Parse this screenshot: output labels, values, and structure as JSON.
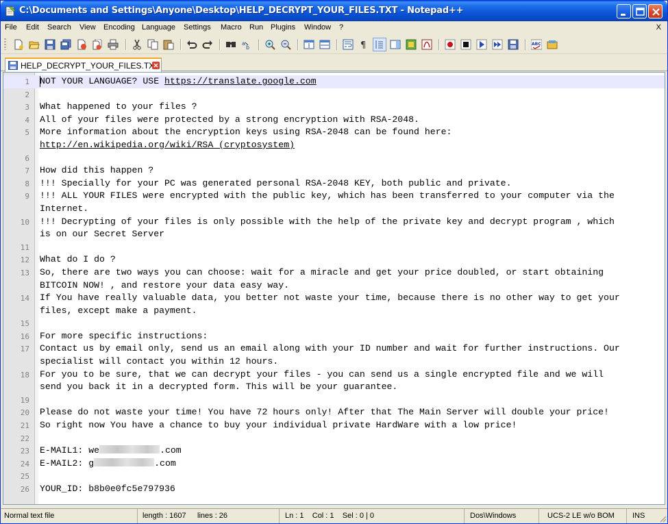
{
  "window": {
    "title": "C:\\Documents and Settings\\Anyone\\Desktop\\HELP_DECRYPT_YOUR_FILES.TXT - Notepad++"
  },
  "menu": [
    "File",
    "Edit",
    "Search",
    "View",
    "Encoding",
    "Language",
    "Settings",
    "Macro",
    "Run",
    "Plugins",
    "Window",
    "?"
  ],
  "menu_close": "X",
  "toolbar_icons": [
    "new-file-icon",
    "open-file-icon",
    "save-icon",
    "save-all-icon",
    "close-icon",
    "close-all-icon",
    "print-icon",
    "cut-icon",
    "copy-icon",
    "paste-icon",
    "undo-icon",
    "redo-icon",
    "find-icon",
    "replace-icon",
    "zoom-in-icon",
    "zoom-out-icon",
    "sync-vertical-icon",
    "sync-horizontal-icon",
    "word-wrap-icon",
    "show-all-chars-icon",
    "indent-guide-icon",
    "doc-map-icon",
    "function-list-icon",
    "folder-as-workspace-icon",
    "record-macro-icon",
    "stop-macro-icon",
    "play-macro-icon",
    "run-macro-multiple-icon",
    "save-macro-icon",
    "spell-check-icon",
    "spell-check-2-icon"
  ],
  "tab": {
    "label": "HELP_DECRYPT_YOUR_FILES.TXT"
  },
  "editor": {
    "lines": [
      {
        "n": "1",
        "text": "NOT YOUR LANGUAGE? USE ",
        "link": "https://translate.google.com"
      },
      {
        "n": "2",
        "text": ""
      },
      {
        "n": "3",
        "text": "What happened to your files ?"
      },
      {
        "n": "4",
        "text": "All of your files were protected by a strong encryption with RSA-2048."
      },
      {
        "n": "5",
        "text": "More information about the encryption keys using RSA-2048 can be found here:"
      },
      {
        "n": "",
        "text": "",
        "link": "http://en.wikipedia.org/wiki/RSA_(cryptosystem)"
      },
      {
        "n": "6",
        "text": ""
      },
      {
        "n": "7",
        "text": "How did this happen ?"
      },
      {
        "n": "8",
        "text": "!!! Specially for your PC was generated personal RSA-2048 KEY, both public and private."
      },
      {
        "n": "9",
        "text": "!!! ALL YOUR FILES were encrypted with the public key, which has been transferred to your computer via the"
      },
      {
        "n": "",
        "text": "Internet."
      },
      {
        "n": "10",
        "text": "!!! Decrypting of your files is only possible with the help of the private key and decrypt program , which"
      },
      {
        "n": "",
        "text": "is on our Secret Server"
      },
      {
        "n": "11",
        "text": ""
      },
      {
        "n": "12",
        "text": "What do I do ?"
      },
      {
        "n": "13",
        "text": "So, there are two ways you can choose: wait for a miracle and get your price doubled, or start obtaining"
      },
      {
        "n": "",
        "text": "BITCOIN NOW! , and restore your data easy way."
      },
      {
        "n": "14",
        "text": "If You have really valuable data, you better not waste your time, because there is no other way to get your"
      },
      {
        "n": "",
        "text": "files, except make a payment."
      },
      {
        "n": "15",
        "text": ""
      },
      {
        "n": "16",
        "text": "For more specific instructions:"
      },
      {
        "n": "17",
        "text": "Contact us by email only, send us an email along with your ID number and wait for further instructions. Our"
      },
      {
        "n": "",
        "text": "specialist will contact you within 12 hours."
      },
      {
        "n": "18",
        "text": "For you to be sure, that we can decrypt your files - you can send us a single encrypted file and we will"
      },
      {
        "n": "",
        "text": "send you back it in a decrypted form. This will be your guarantee."
      },
      {
        "n": "19",
        "text": ""
      },
      {
        "n": "20",
        "text": "Please do not waste your time! You have 72 hours only! After that The Main Server will double your price!"
      },
      {
        "n": "21",
        "text": "So right now You have a chance to buy your individual private HardWare with a low price!"
      },
      {
        "n": "22",
        "text": ""
      },
      {
        "n": "23",
        "text": "E-MAIL1: we",
        "redacted": true,
        "after": ".com"
      },
      {
        "n": "24",
        "text": "E-MAIL2: g",
        "redacted": true,
        "after": ".com"
      },
      {
        "n": "25",
        "text": ""
      },
      {
        "n": "26",
        "text": "YOUR_ID: b8b0e0fc5e797936"
      }
    ]
  },
  "status": {
    "file_type": "Normal text file",
    "length": "length : 1607",
    "lines": "lines : 26",
    "position": "Ln : 1    Col : 1    Sel : 0 | 0",
    "eol": "Dos\\Windows",
    "encoding": "UCS-2 LE w/o BOM",
    "mode": "INS"
  }
}
